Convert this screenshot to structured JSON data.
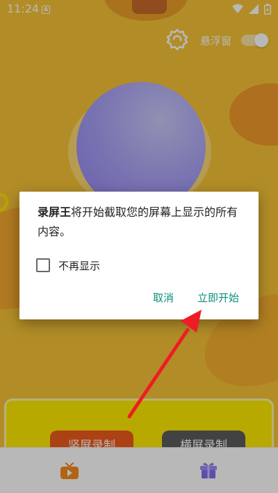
{
  "status_bar": {
    "time": "11:24",
    "notification_letter": "A"
  },
  "top": {
    "floating_window_label": "悬浮窗"
  },
  "dialog": {
    "app_name": "录屏王",
    "message": "将开始截取您的屏幕上显示的所有内容。",
    "checkbox_label": "不再显示",
    "cancel_label": "取消",
    "start_label": "立即开始"
  },
  "panel": {
    "portrait_button": "竖屏录制",
    "landscape_button": "横屏录制"
  },
  "colors": {
    "background": "#f7c437",
    "accent_green": "#0b8f7a",
    "arrow_red": "#ee1c25",
    "portrait_orange": "#ef5a1c",
    "record_circle": "#a79df6"
  },
  "icons": {
    "settings": "gear-icon",
    "tv": "tv-icon",
    "gift": "gift-icon"
  }
}
